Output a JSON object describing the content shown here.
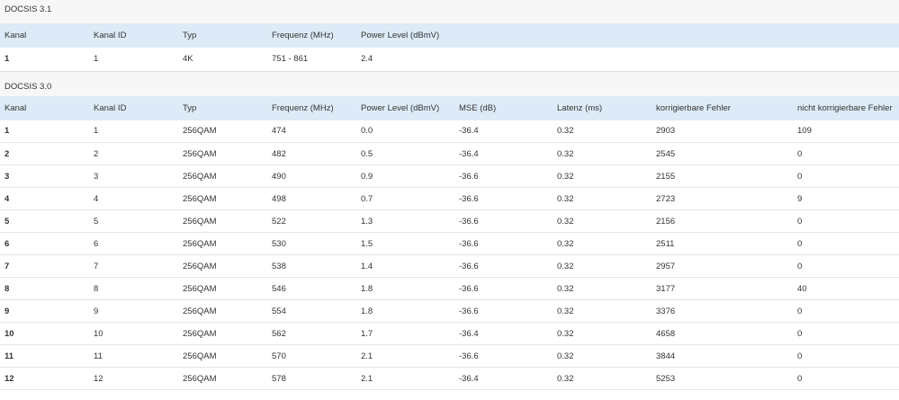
{
  "docsis31": {
    "title": "DOCSIS 3.1",
    "headers": [
      "Kanal",
      "Kanal ID",
      "Typ",
      "Frequenz (MHz)",
      "Power Level (dBmV)"
    ],
    "rows": [
      [
        "1",
        "1",
        "4K",
        "751 - 861",
        "2.4"
      ]
    ]
  },
  "docsis30": {
    "title": "DOCSIS 3.0",
    "headers": [
      "Kanal",
      "Kanal ID",
      "Typ",
      "Frequenz (MHz)",
      "Power Level (dBmV)",
      "MSE (dB)",
      "Latenz (ms)",
      "korrigierbare Fehler",
      "nicht korrigierbare Fehler"
    ],
    "rows": [
      [
        "1",
        "1",
        "256QAM",
        "474",
        "0.0",
        "-36.4",
        "0.32",
        "2903",
        "109"
      ],
      [
        "2",
        "2",
        "256QAM",
        "482",
        "0.5",
        "-36.4",
        "0.32",
        "2545",
        "0"
      ],
      [
        "3",
        "3",
        "256QAM",
        "490",
        "0.9",
        "-36.6",
        "0.32",
        "2155",
        "0"
      ],
      [
        "4",
        "4",
        "256QAM",
        "498",
        "0.7",
        "-36.6",
        "0.32",
        "2723",
        "9"
      ],
      [
        "5",
        "5",
        "256QAM",
        "522",
        "1.3",
        "-36.6",
        "0.32",
        "2156",
        "0"
      ],
      [
        "6",
        "6",
        "256QAM",
        "530",
        "1.5",
        "-36.6",
        "0.32",
        "2511",
        "0"
      ],
      [
        "7",
        "7",
        "256QAM",
        "538",
        "1.4",
        "-36.6",
        "0.32",
        "2957",
        "0"
      ],
      [
        "8",
        "8",
        "256QAM",
        "546",
        "1.8",
        "-36.6",
        "0.32",
        "3177",
        "40"
      ],
      [
        "9",
        "9",
        "256QAM",
        "554",
        "1.8",
        "-36.6",
        "0.32",
        "3376",
        "0"
      ],
      [
        "10",
        "10",
        "256QAM",
        "562",
        "1.7",
        "-36.4",
        "0.32",
        "4658",
        "0"
      ],
      [
        "11",
        "11",
        "256QAM",
        "570",
        "2.1",
        "-36.6",
        "0.32",
        "3844",
        "0"
      ],
      [
        "12",
        "12",
        "256QAM",
        "578",
        "2.1",
        "-36.4",
        "0.32",
        "5253",
        "0"
      ]
    ]
  }
}
